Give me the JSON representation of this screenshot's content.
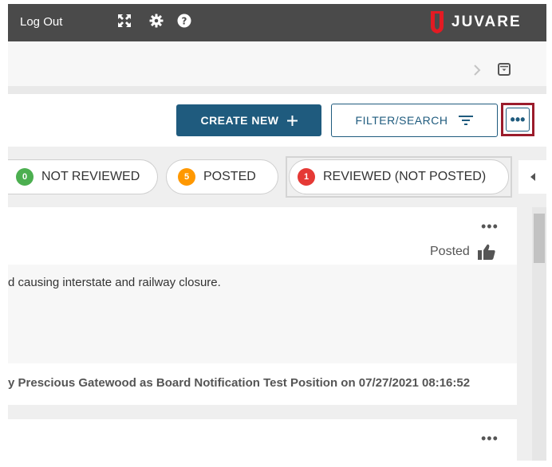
{
  "topbar": {
    "logout_label": "Log Out",
    "icons": [
      "expand-icon",
      "gear-icon",
      "help-icon"
    ],
    "brand": "JUVARE",
    "brand_color": "#e31b23",
    "background": "#4a4a4a"
  },
  "subbar": {
    "icons": [
      "chevron-right-icon",
      "calendar-icon"
    ]
  },
  "actions": {
    "create_label": "CREATE NEW",
    "create_icon": "plus-icon",
    "filter_label": "FILTER/SEARCH",
    "filter_icon": "filter-icon",
    "more_label": "•••",
    "accent": "#1f5b7e",
    "highlight": "#9b1c2b"
  },
  "filters": [
    {
      "count": "0",
      "label": "NOT REVIEWED",
      "color": "#4caf50"
    },
    {
      "count": "5",
      "label": "POSTED",
      "color": "#ff9800"
    },
    {
      "count": "1",
      "label": "REVIEWED (NOT POSTED)",
      "color": "#e53935"
    }
  ],
  "cards": [
    {
      "menu": "•••",
      "status": "Posted",
      "status_icon": "thumbs-up-icon",
      "description": "d causing interstate and railway closure.",
      "footer": "y Prescious Gatewood as Board Notification Test Position on 07/27/2021 08:16:52"
    },
    {
      "menu": "•••"
    }
  ]
}
